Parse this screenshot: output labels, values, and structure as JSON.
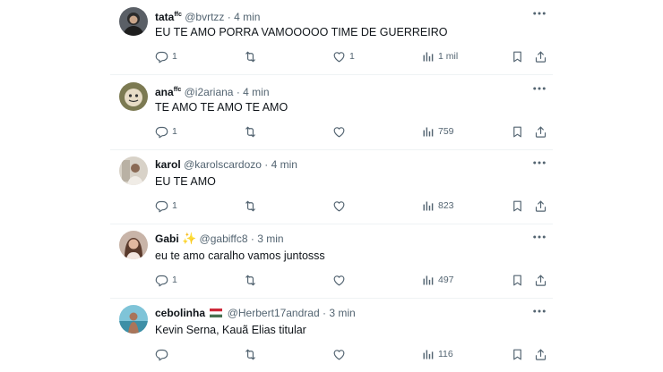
{
  "tweets": [
    {
      "name": "tata",
      "name_sup": "ffc",
      "handle": "@bvrtzz",
      "time": "4 min",
      "text": "EU TE AMO PORRA VAMOOOOO TIME DE GUERREIRO",
      "replies": "1",
      "retweets": "",
      "likes": "1",
      "views": "1 mil"
    },
    {
      "name": "ana",
      "name_sup": "ffc",
      "handle": "@i2ariana",
      "time": "4 min",
      "text": "TE AMO TE AMO TE AMO",
      "replies": "1",
      "retweets": "",
      "likes": "",
      "views": "759"
    },
    {
      "name": "karol",
      "name_sup": "",
      "handle": "@karolscardozo",
      "time": "4 min",
      "text": "EU TE AMO",
      "replies": "1",
      "retweets": "",
      "likes": "",
      "views": "823"
    },
    {
      "name": "Gabi",
      "name_sup": "",
      "handle": "@gabiffc8",
      "time": "3 min",
      "text": "eu te amo caralho vamos juntosss",
      "replies": "1",
      "retweets": "",
      "likes": "",
      "views": "497"
    },
    {
      "name": "cebolinha",
      "name_sup": "",
      "handle": "@Herbert17andrad",
      "time": "3 min",
      "text": "Kevin Serna, Kauã Elias titular",
      "replies": "",
      "retweets": "",
      "likes": "",
      "views": "116"
    }
  ],
  "separator": "·",
  "colors": {
    "text_primary": "#0f1419",
    "text_secondary": "#536471",
    "divider": "#eff3f4"
  }
}
